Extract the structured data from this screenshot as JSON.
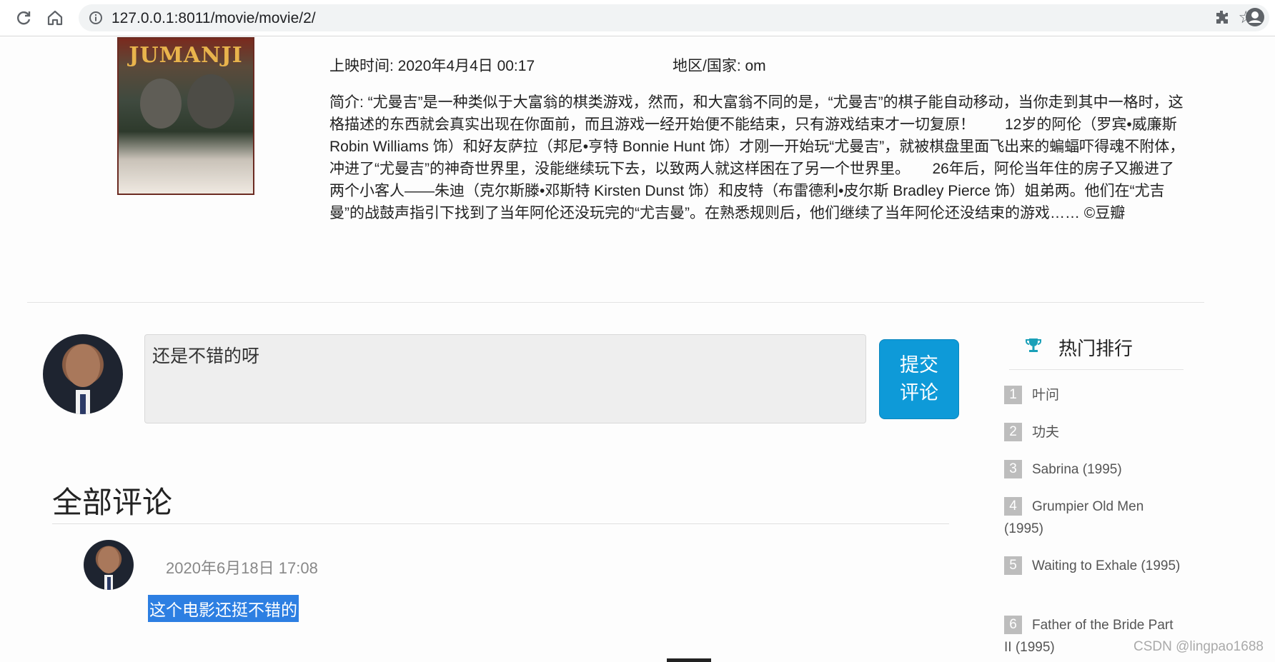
{
  "browser": {
    "url": "127.0.0.1:8011/movie/movie/2/"
  },
  "movie": {
    "poster_title": "JUMANJI",
    "release_label": "上映时间: 2020年4月4日 00:17",
    "region_label": "地区/国家: om",
    "synopsis": "简介: “尤曼吉”是一种类似于大富翁的棋类游戏，然而，和大富翁不同的是，“尤曼吉”的棋子能自动移动，当你走到其中一格时，这格描述的东西就会真实出现在你面前，而且游戏一经开始便不能结束，只有游戏结束才一切复原！　　12岁的阿伦（罗宾•威廉斯 Robin Williams 饰）和好友萨拉（邦尼•亨特 Bonnie Hunt 饰）才刚一开始玩“尤曼吉”，就被棋盘里面飞出来的蝙蝠吓得魂不附体，冲进了“尤曼吉”的神奇世界里，没能继续玩下去，以致两人就这样困在了另一个世界里。　　26年后，阿伦当年住的房子又搬进了两个小客人——朱迪（克尔斯滕•邓斯特 Kirsten Dunst 饰）和皮特（布雷德利•皮尔斯 Bradley Pierce 饰）姐弟两。他们在“尤吉曼”的战鼓声指引下找到了当年阿伦还没玩完的“尤吉曼”。在熟悉规则后，他们继续了当年阿伦还没结束的游戏…… ©豆瓣"
  },
  "comment_form": {
    "value": "还是不错的呀",
    "submit_line1": "提交",
    "submit_line2": "评论"
  },
  "comments": {
    "heading": "全部评论",
    "items": [
      {
        "date": "2020年6月18日 17:08",
        "text": "这个电影还挺不错的"
      }
    ]
  },
  "hot": {
    "title": "热门排行",
    "items": [
      {
        "rank": "1",
        "title": "叶问"
      },
      {
        "rank": "2",
        "title": "功夫"
      },
      {
        "rank": "3",
        "title": "Sabrina (1995)"
      },
      {
        "rank": "4",
        "title": "Grumpier Old Men (1995)"
      },
      {
        "rank": "5",
        "title": "Waiting to Exhale (1995)"
      },
      {
        "rank": "6",
        "title": "Father of the Bride Part II (1995)"
      }
    ]
  },
  "watermark": "CSDN @lingpao1688",
  "colors": {
    "accent": "#0e9ad8",
    "selection": "#2d7fe2",
    "trophy": "#1aa0b8"
  }
}
